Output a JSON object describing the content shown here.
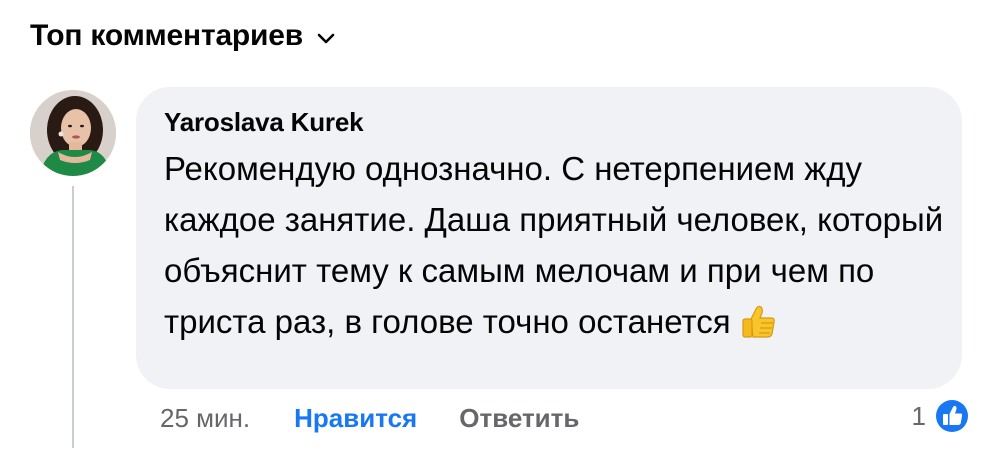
{
  "header": {
    "title": "Топ комментариев",
    "dropdown_icon": "chevron-down-icon"
  },
  "comment": {
    "author": "Yaroslava Kurek",
    "text": "Рекомендую однозначно. С нетерпением жду каждое занятие. Даша приятный человек, который объяснит тему к самым мелочам и при чем по триста раз, в голове точно останется",
    "emoji": "thumbs-up-emoji",
    "time": "25 мин.",
    "like_label": "Нравится",
    "reply_label": "Ответить",
    "reactions_count": "1",
    "reaction_icon": "like-reaction-icon"
  },
  "colors": {
    "bubble": "#f0f2f5",
    "accent": "#1877f2",
    "secondary_text": "#65676b",
    "primary_text": "#050505"
  }
}
